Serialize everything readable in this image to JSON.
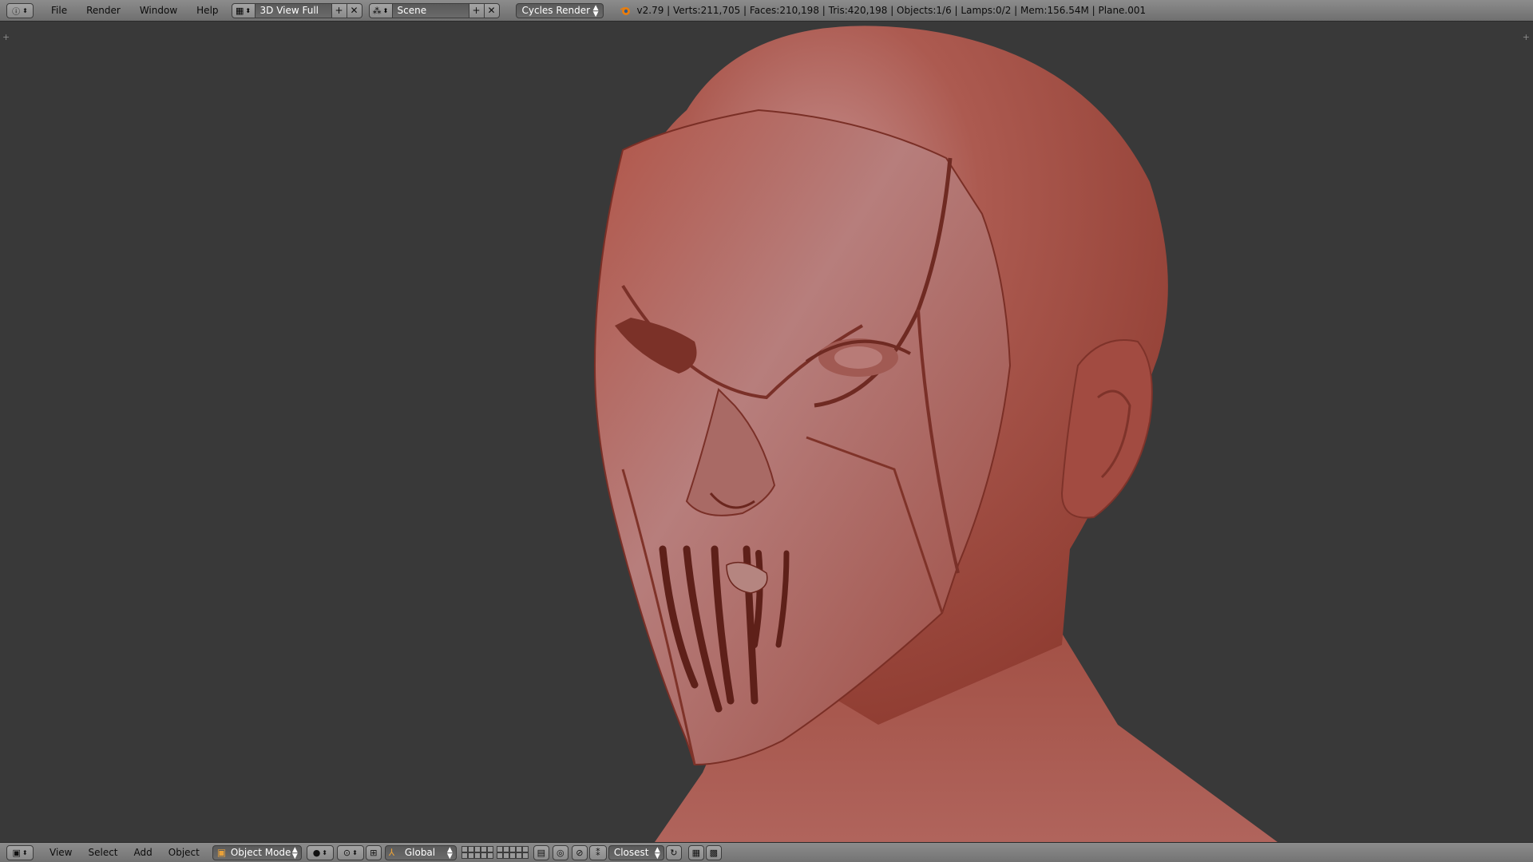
{
  "top_header": {
    "menus": [
      "File",
      "Render",
      "Window",
      "Help"
    ],
    "screen_layout": "3D View Full",
    "scene": "Scene",
    "render_engine": "Cycles Render",
    "stats": "v2.79 | Verts:211,705 | Faces:210,198 | Tris:420,198 | Objects:1/6 | Lamps:0/2 | Mem:156.54M | Plane.001"
  },
  "bottom_header": {
    "menus": [
      "View",
      "Select",
      "Add",
      "Object"
    ],
    "mode": "Object Mode",
    "orientation": "Global",
    "snap_target": "Closest"
  },
  "colors": {
    "viewport_bg": "#393939",
    "header_bg": "#7f7f7f",
    "mesh_clay": "#a5483c"
  },
  "icons": [
    "info-editor-icon",
    "screen-layout-icon",
    "add-icon",
    "close-icon",
    "scene-icon",
    "blender-logo-icon",
    "3d-view-editor-icon",
    "object-mode-icon",
    "viewport-shading-icon",
    "pivot-icon",
    "manipulator-icon",
    "transform-orientation-icon",
    "layers-icon",
    "lock-camera-icon",
    "proportional-edit-icon",
    "snap-icon",
    "render-preview-icon"
  ]
}
